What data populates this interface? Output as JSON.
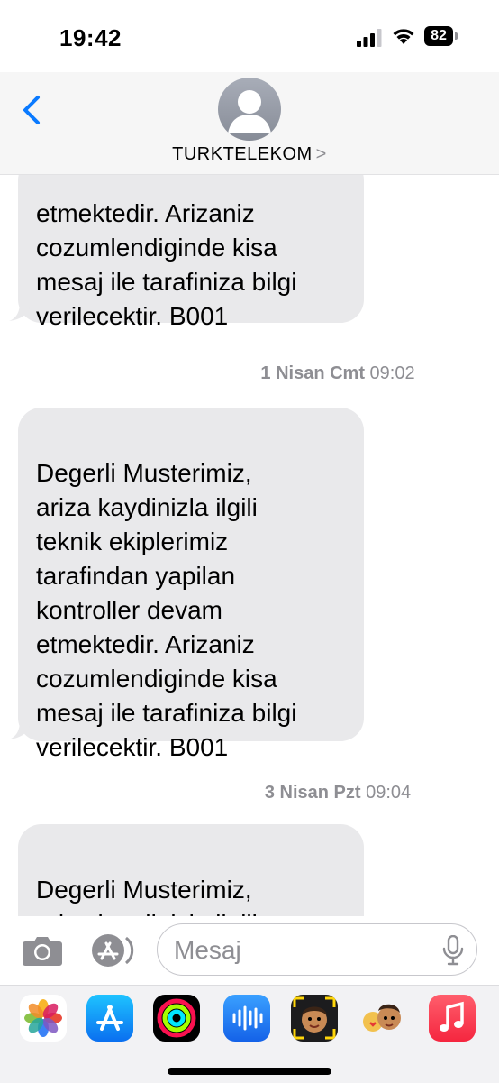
{
  "status_bar": {
    "time": "19:42",
    "battery_level": "82",
    "icons": [
      "signal-icon",
      "wifi-icon",
      "battery-icon"
    ]
  },
  "header": {
    "contact_name": "TURKTELEKOM",
    "chevron": ">",
    "icons": [
      "back-chevron-icon",
      "contact-avatar-icon"
    ]
  },
  "messages": [
    {
      "type": "partial",
      "text": "etmektedir. Arizaniz\ncozumlendiginde kisa\nmesaj ile tarafiniza bilgi\nverilecektir. B001"
    },
    {
      "type": "timestamp",
      "day": "1 Nisan Cmt",
      "time": "09:02"
    },
    {
      "type": "bubble",
      "text": "Degerli Musterimiz,\nariza kaydinizla ilgili\nteknik ekiplerimiz\ntarafindan yapilan\nkontroller devam\netmektedir. Arizaniz\ncozumlendiginde kisa\nmesaj ile tarafiniza bilgi\nverilecektir. B001"
    },
    {
      "type": "timestamp",
      "day": "3 Nisan Pzt",
      "time": "09:04"
    },
    {
      "type": "bubble",
      "text": "Degerli Musterimiz,\nariza kaydinizla ilgili\nteknik ekiplerimiz"
    }
  ],
  "input_bar": {
    "placeholder": "Mesaj",
    "icons": [
      "camera-icon",
      "app-store-icon",
      "microphone-icon"
    ]
  },
  "app_strip": {
    "apps": [
      "photos-icon",
      "app-store-icon",
      "fitness-icon",
      "audio-message-icon",
      "memoji-icon",
      "memoji-stickers-icon",
      "music-icon"
    ]
  },
  "colors": {
    "accent": "#0a7aff",
    "bubble_gray": "#e9e9eb",
    "secondary_text": "#8e8e93"
  }
}
